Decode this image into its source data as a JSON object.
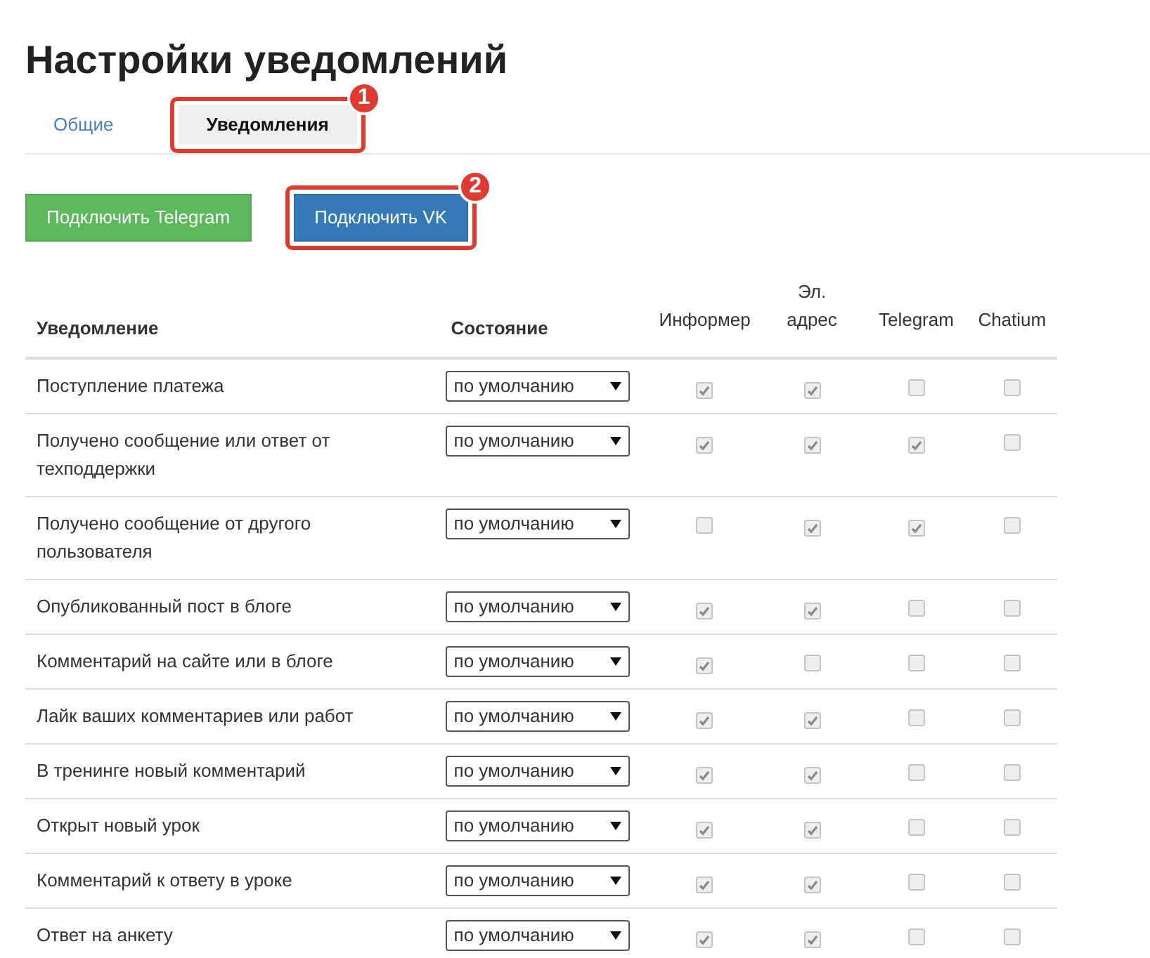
{
  "title": "Настройки уведомлений",
  "tabs": [
    {
      "label": "Общие",
      "selected": false
    },
    {
      "label": "Уведомления",
      "selected": true,
      "callout": "1"
    }
  ],
  "buttons": [
    {
      "label": "Подключить Telegram",
      "color": "#5cb85c"
    },
    {
      "label": "Подключить VK",
      "color": "#337ab7",
      "callout": "2"
    }
  ],
  "table": {
    "columns": [
      {
        "label": "Уведомление",
        "kind": "text"
      },
      {
        "label": "Состояние",
        "kind": "text"
      },
      {
        "label": "Информер",
        "kind": "check"
      },
      {
        "label": "Эл. адрес",
        "kind": "check"
      },
      {
        "label": "Telegram",
        "kind": "check"
      },
      {
        "label": "Chatium",
        "kind": "check"
      }
    ],
    "rows": [
      {
        "name": "Поступление платежа",
        "state": "по умолчанию",
        "checks": [
          true,
          true,
          false,
          false
        ]
      },
      {
        "name": "Получено сообщение или ответ от техподдержки",
        "state": "по умолчанию",
        "checks": [
          true,
          true,
          true,
          false
        ]
      },
      {
        "name": "Получено сообщение от другого пользователя",
        "state": "по умолчанию",
        "checks": [
          false,
          true,
          true,
          false
        ]
      },
      {
        "name": "Опубликованный пост в блоге",
        "state": "по умолчанию",
        "checks": [
          true,
          true,
          false,
          false
        ]
      },
      {
        "name": "Комментарий на сайте или в блоге",
        "state": "по умолчанию",
        "checks": [
          true,
          false,
          false,
          false
        ]
      },
      {
        "name": "Лайк ваших комментариев или работ",
        "state": "по умолчанию",
        "checks": [
          true,
          true,
          false,
          false
        ]
      },
      {
        "name": "В тренинге новый комментарий",
        "state": "по умолчанию",
        "checks": [
          true,
          true,
          false,
          false
        ]
      },
      {
        "name": "Открыт новый урок",
        "state": "по умолчанию",
        "checks": [
          true,
          true,
          false,
          false
        ]
      },
      {
        "name": "Комментарий к ответу в уроке",
        "state": "по умолчанию",
        "checks": [
          true,
          true,
          false,
          false
        ]
      },
      {
        "name": "Ответ на анкету",
        "state": "по умолчанию",
        "checks": [
          true,
          true,
          false,
          false
        ]
      }
    ]
  }
}
